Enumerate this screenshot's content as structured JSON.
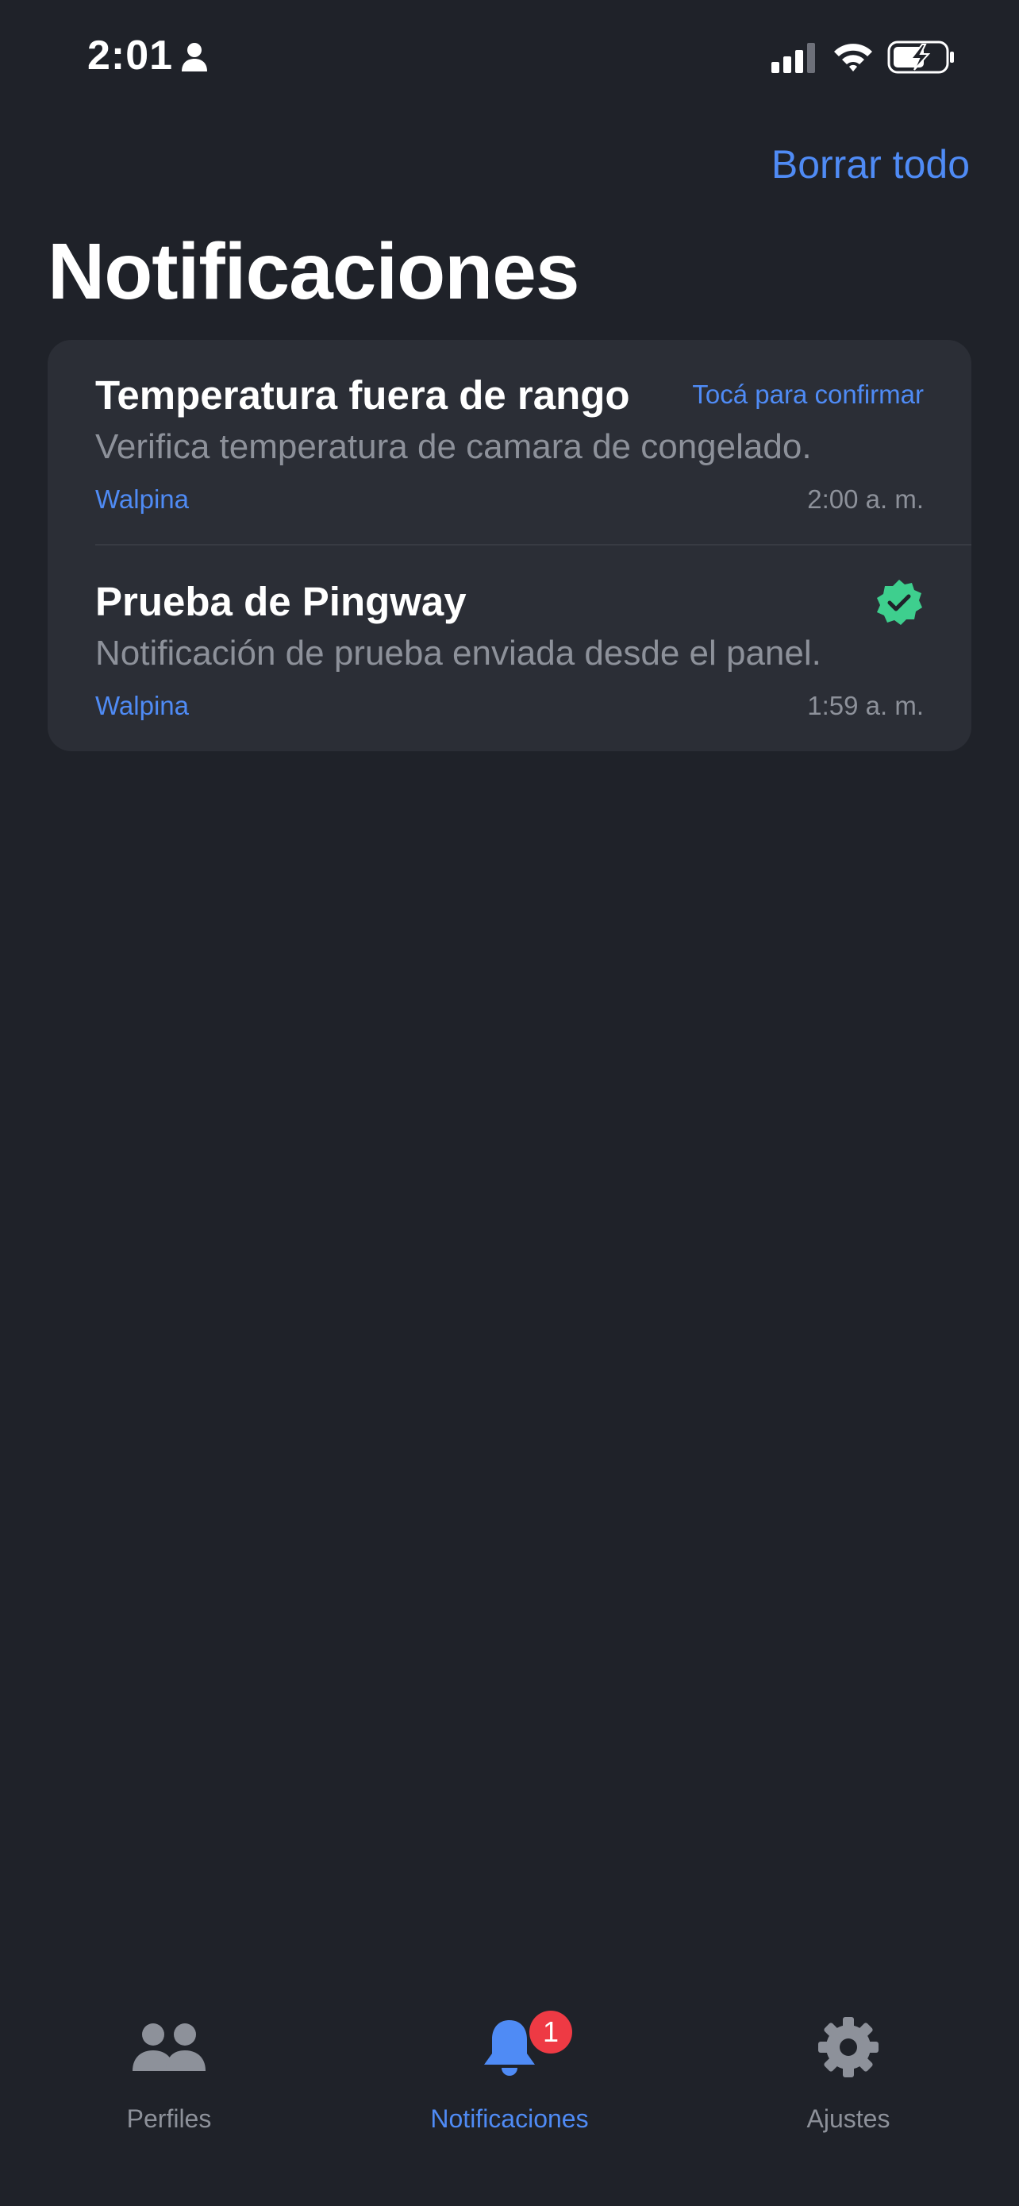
{
  "status_bar": {
    "time": "2:01"
  },
  "header": {
    "clear_all_label": "Borrar todo",
    "title": "Notificaciones"
  },
  "notifications": [
    {
      "title": "Temperatura fuera de rango",
      "body": "Verifica temperatura de camara de congelado.",
      "source": "Walpina",
      "time": "2:00 a. m.",
      "action_label": "Tocá para confirmar"
    },
    {
      "title": "Prueba de Pingway",
      "body": "Notificación de prueba enviada desde el panel.",
      "source": "Walpina",
      "time": "1:59 a. m.",
      "status_icon": "verified-check-icon"
    }
  ],
  "tab_bar": {
    "tabs": [
      {
        "label": "Perfiles",
        "icon": "people-icon"
      },
      {
        "label": "Notificaciones",
        "icon": "bell-icon",
        "badge": "1",
        "active": true
      },
      {
        "label": "Ajustes",
        "icon": "gear-icon"
      }
    ]
  },
  "colors": {
    "background": "#1f2229",
    "card": "#2b2e36",
    "accent": "#4f8bf5",
    "secondary_text": "#8d919a",
    "badge": "#ee3a44",
    "verified": "#3ecf8e"
  }
}
